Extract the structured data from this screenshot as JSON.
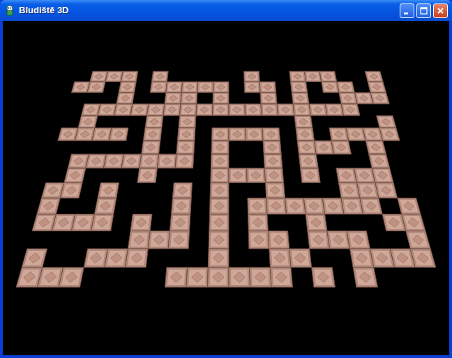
{
  "window": {
    "title": "Bludiště 3D"
  },
  "maze": {
    "rows": [
      ".###.#.....#..###..#",
      "##.#.#####.##.#.##.#",
      "...#..##.#..#.#..###",
      ".#################..",
      ".#...#.#......#....#",
      "####.#.#.####.#.####",
      ".....#.#.#..#.###.#.",
      ".#######.#..#.#...#.",
      ".#...#...####.#.###.",
      "##.#...#.#..#...###.",
      "#..#...#.#.#######.#",
      "####.#.#.#.#..#...##",
      ".....###.#.##.###..#",
      "#..###...#..##..####",
      "###....######.#.#..."
    ]
  }
}
